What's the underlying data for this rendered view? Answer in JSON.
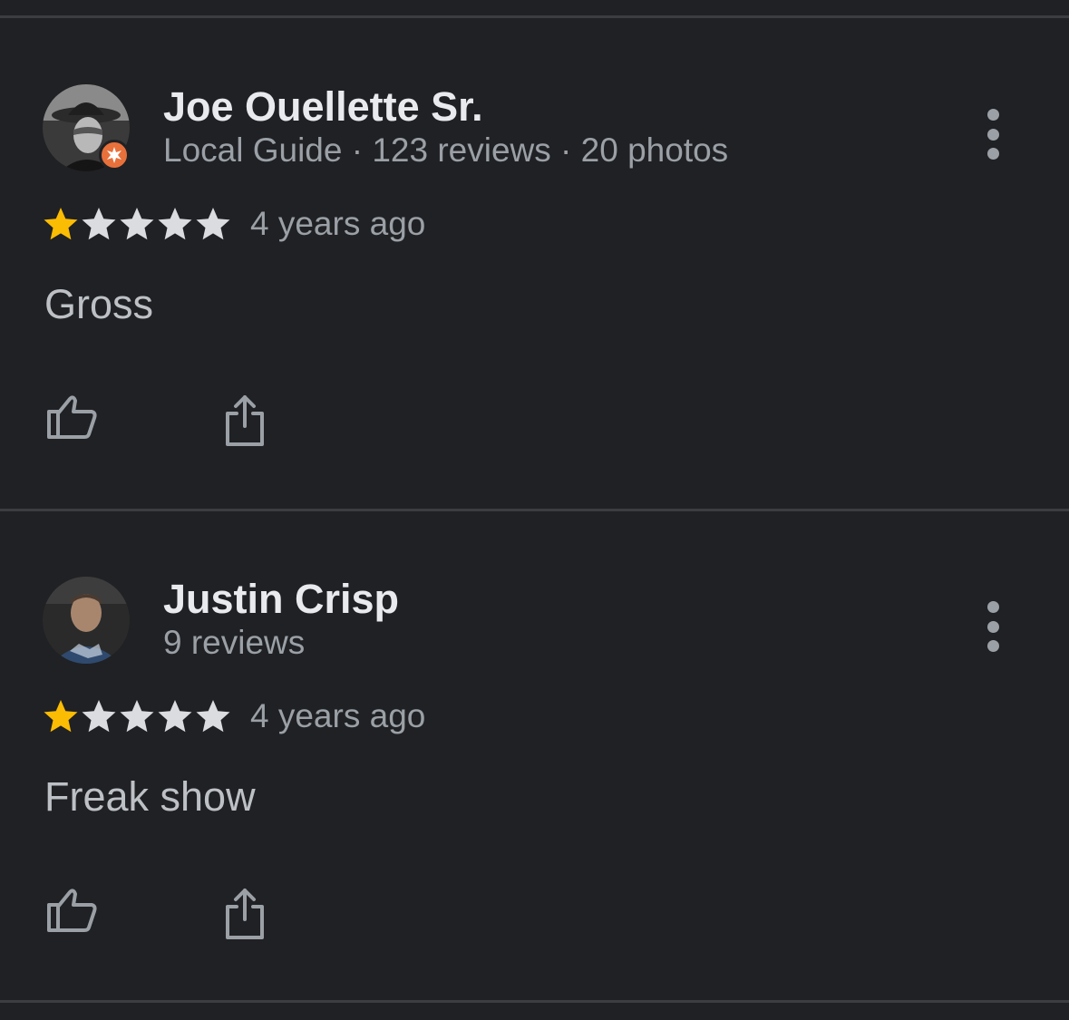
{
  "colors": {
    "background": "#202124",
    "divider": "#3c3d41",
    "name": "#e8eaed",
    "secondary_text": "#9aa0a6",
    "body_text": "#bdc1c6",
    "star_filled": "#fbbc04",
    "star_empty": "#dadce0",
    "local_guide_badge": "#e8703b"
  },
  "reviews": [
    {
      "author": "Joe Ouellette Sr.",
      "meta": "Local Guide · 123 reviews · 20 photos",
      "local_guide": true,
      "rating": 1,
      "max_rating": 5,
      "time": "4 years ago",
      "text": "Gross",
      "icons": {
        "avatar": "avatar-icon",
        "more": "more-options-icon",
        "like": "thumbs-up-icon",
        "share": "share-icon"
      }
    },
    {
      "author": "Justin Crisp",
      "meta": "9 reviews",
      "local_guide": false,
      "rating": 1,
      "max_rating": 5,
      "time": "4 years ago",
      "text": "Freak show",
      "icons": {
        "avatar": "avatar-icon",
        "more": "more-options-icon",
        "like": "thumbs-up-icon",
        "share": "share-icon"
      }
    }
  ]
}
